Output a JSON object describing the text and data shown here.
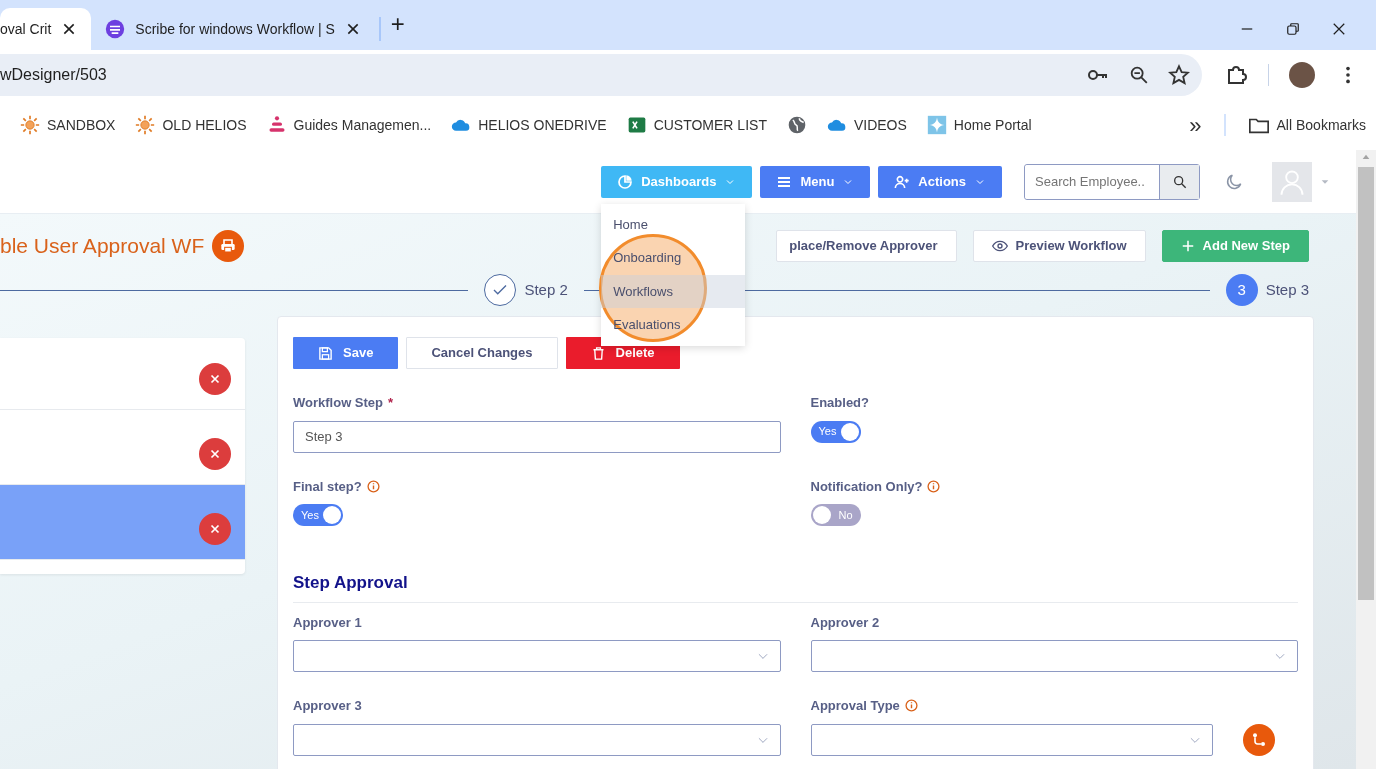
{
  "browser": {
    "tabs": [
      {
        "title": "oval Crit",
        "selected": true
      },
      {
        "title": "Scribe for windows Workflow | S",
        "selected": false
      }
    ],
    "new_tab": "+",
    "url": "wDesigner/503",
    "bookmarks": [
      {
        "kind": "sun",
        "label": "SANDBOX"
      },
      {
        "kind": "sun",
        "label": "OLD HELIOS"
      },
      {
        "kind": "dots",
        "label": "Guides Managemen..."
      },
      {
        "kind": "cloud",
        "label": "HELIOS ONEDRIVE"
      },
      {
        "kind": "sheet",
        "label": "CUSTOMER LIST"
      },
      {
        "kind": "globe"
      },
      {
        "kind": "cloud",
        "label": "VIDEOS"
      },
      {
        "kind": "sparkle",
        "label": "Home Portal"
      }
    ],
    "overflow": "»",
    "all_bookmarks": "All Bookmarks"
  },
  "navbar": {
    "buttons": [
      {
        "kind": "dashboards",
        "label": "Dashboards"
      },
      {
        "kind": "menu",
        "label": "Menu"
      },
      {
        "kind": "actions",
        "label": "Actions"
      }
    ],
    "search": {
      "placeholder": "Search Employee.."
    },
    "dropdown": [
      {
        "label": "Home",
        "selected": false
      },
      {
        "label": "Onboarding",
        "selected": false
      },
      {
        "label": "Workflows",
        "selected": true
      },
      {
        "label": "Evaluations",
        "selected": false
      }
    ]
  },
  "page": {
    "title": "ble User Approval WF",
    "toolbar": [
      {
        "kind": "outline",
        "label": "place/Remove Approver"
      },
      {
        "kind": "preview",
        "label": "Preview Workflow"
      },
      {
        "kind": "add",
        "label": "Add New Step"
      }
    ],
    "stepper": [
      {
        "kind": "done",
        "label": "Step 2"
      },
      {
        "kind": "current",
        "number": "3",
        "label": "Step 3"
      }
    ],
    "steps_list": [
      {
        "selected": false
      },
      {
        "selected": false
      },
      {
        "selected": true
      }
    ]
  },
  "card": {
    "actions": [
      {
        "kind": "save",
        "label": "Save"
      },
      {
        "kind": "cancel",
        "label": "Cancel Changes"
      },
      {
        "kind": "delete",
        "label": "Delete"
      }
    ],
    "workflow_step": {
      "label": "Workflow Step",
      "required_mark": "*",
      "value": "Step 3"
    },
    "toggles": [
      {
        "label": "Enabled?",
        "on": true,
        "text": "Yes"
      },
      {
        "label": "Final step?",
        "info": true,
        "on": true,
        "text": "Yes"
      },
      {
        "label": "Notification Only?",
        "info": true,
        "on": false,
        "text": "No"
      }
    ],
    "section": "Step Approval",
    "selects": [
      {
        "label": "Approver 1"
      },
      {
        "label": "Approver 2"
      },
      {
        "label": "Approver 3"
      },
      {
        "label": "Approval Type",
        "info": true
      }
    ]
  }
}
